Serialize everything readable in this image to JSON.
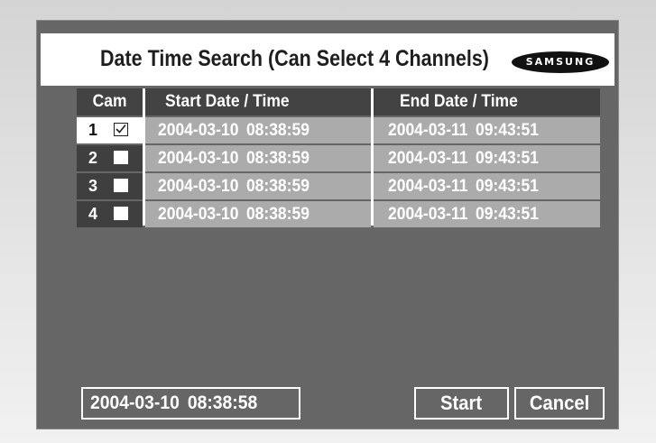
{
  "title": "Date Time Search (Can Select 4 Channels)",
  "logo_text": "SAMSUNG",
  "table": {
    "headers": {
      "cam": "Cam",
      "start": "Start Date / Time",
      "end": "End Date / Time"
    },
    "rows": [
      {
        "cam": "1",
        "checked": true,
        "start": "2004-03-10  08:38:59",
        "end": "2004-03-11  09:43:51"
      },
      {
        "cam": "2",
        "checked": false,
        "start": "2004-03-10  08:38:59",
        "end": "2004-03-11  09:43:51"
      },
      {
        "cam": "3",
        "checked": false,
        "start": "2004-03-10  08:38:59",
        "end": "2004-03-11  09:43:51"
      },
      {
        "cam": "4",
        "checked": false,
        "start": "2004-03-10  08:38:59",
        "end": "2004-03-11  09:43:51"
      }
    ]
  },
  "current_datetime": "2004-03-10  08:38:58",
  "buttons": {
    "start": "Start",
    "cancel": "Cancel"
  },
  "colors": {
    "panel": "#666666",
    "header_bg": "#434343",
    "time_cell_bg": "#ababab",
    "cam_cell_bg": "#3f3f3f",
    "selected_cam_bg": "#ffffff"
  }
}
